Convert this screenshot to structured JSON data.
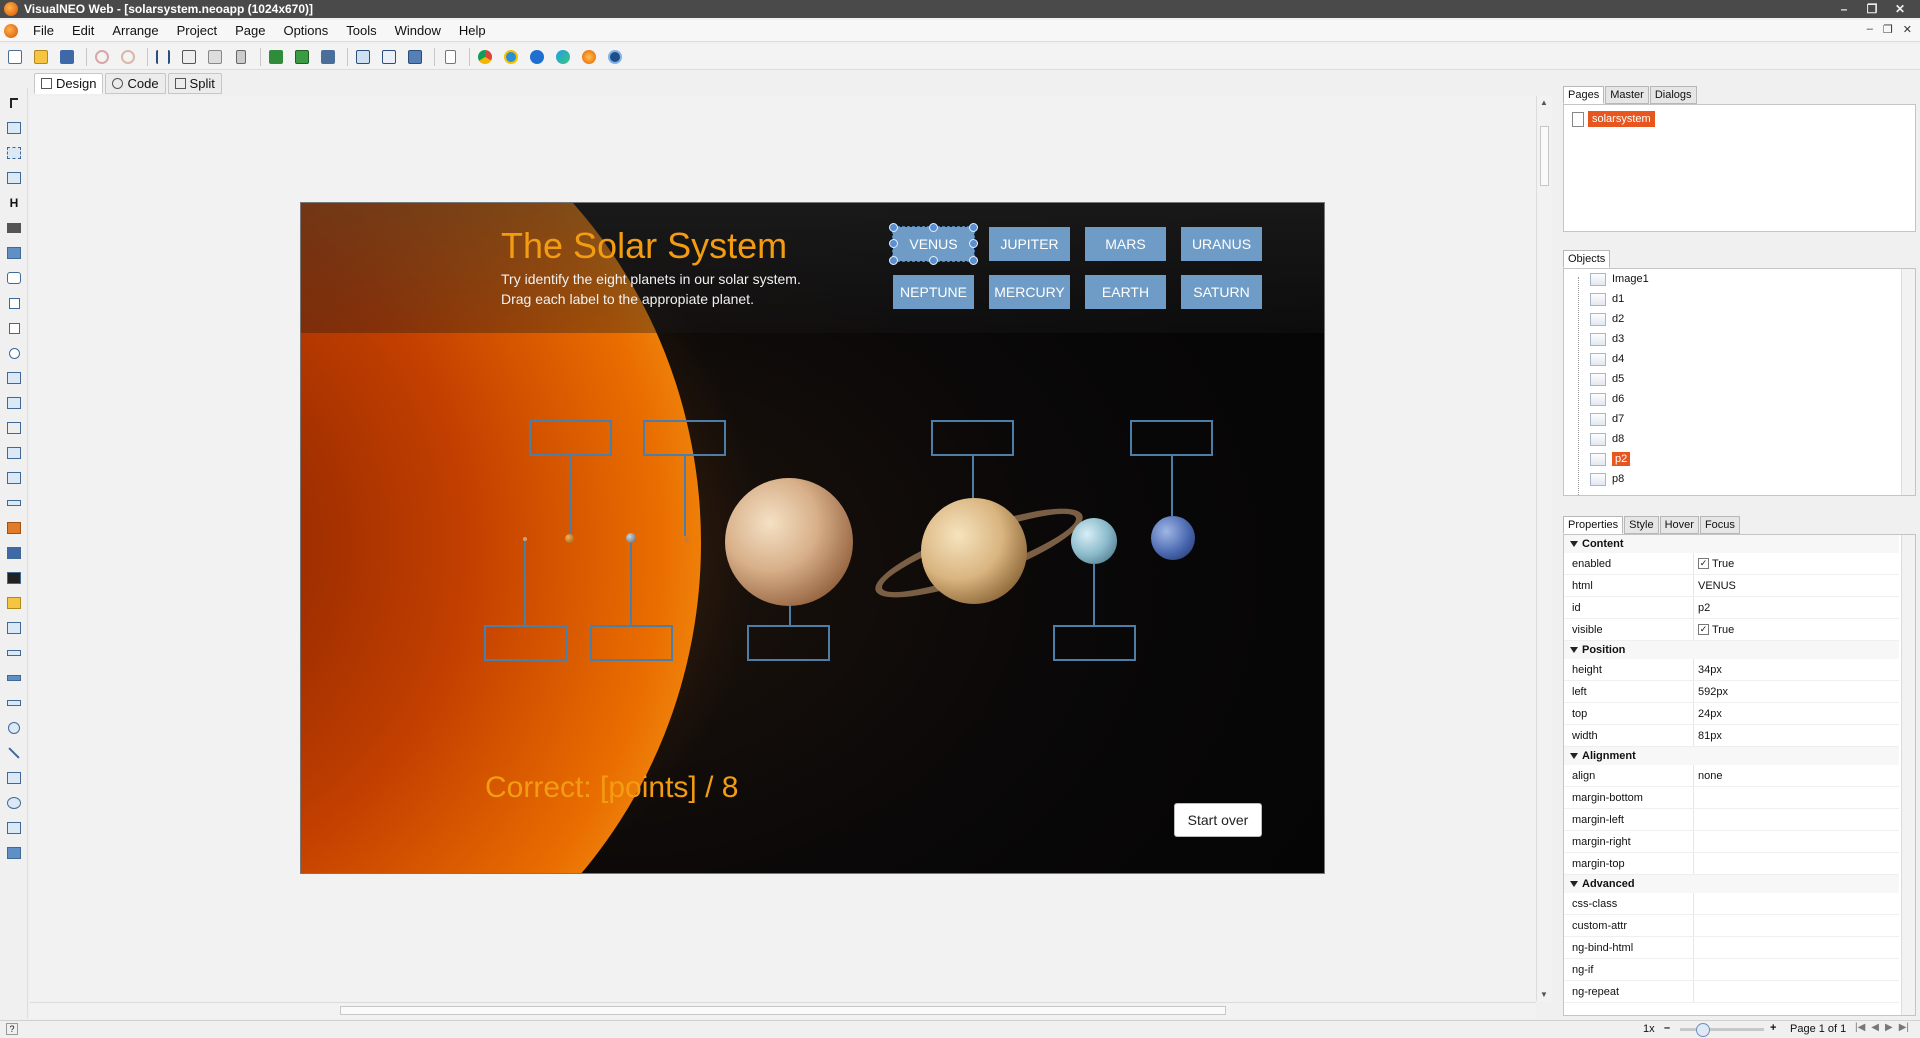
{
  "window": {
    "title": "VisualNEO Web - [solarsystem.neoapp (1024x670)]",
    "controls": [
      "–",
      "❐",
      "✕"
    ]
  },
  "menubar": {
    "items": [
      "File",
      "Edit",
      "Arrange",
      "Project",
      "Page",
      "Options",
      "Tools",
      "Window",
      "Help"
    ],
    "mdi_controls": [
      "–",
      "❐",
      "✕"
    ]
  },
  "toolbar": {
    "buttons": [
      "new-icon",
      "open-icon",
      "save-icon",
      "undo-icon",
      "redo-icon",
      "cut-icon",
      "copy-icon",
      "paste-icon",
      "delete-icon",
      "group-icon",
      "ungroup-icon",
      "order-icon",
      "page-icon",
      "preview-icon",
      "publish-icon",
      "doc-icon",
      "chrome-icon",
      "ie-icon",
      "edge-icon",
      "edge-new-icon",
      "firefox-icon",
      "other-browser-icon"
    ]
  },
  "view_tabs": [
    "Design",
    "Code",
    "Split"
  ],
  "app": {
    "title": "The Solar System",
    "subtitle1": "Try identify the eight planets in our solar system.",
    "subtitle2": "Drag each label to the appropiate planet.",
    "labels_row1": [
      "VENUS",
      "JUPITER",
      "MARS",
      "URANUS"
    ],
    "labels_row2": [
      "NEPTUNE",
      "MERCURY",
      "EARTH",
      "SATURN"
    ],
    "score": "Correct: [points] / 8",
    "start_over": "Start over",
    "colors": {
      "title": "#f39c12",
      "label_bg": "#6e9cc6",
      "drop_border": "#4d7ea8"
    }
  },
  "pages_panel": {
    "tabs": [
      "Pages",
      "Master",
      "Dialogs"
    ],
    "items": [
      "solarsystem"
    ]
  },
  "objects_panel": {
    "tabs": [
      "Objects"
    ],
    "items": [
      "Image1",
      "d1",
      "d2",
      "d3",
      "d4",
      "d5",
      "d6",
      "d7",
      "d8",
      "p2",
      "p8"
    ],
    "selected": "p2"
  },
  "properties_panel": {
    "tabs": [
      "Properties",
      "Style",
      "Hover",
      "Focus"
    ],
    "content": {
      "section": "Content",
      "rows": [
        [
          "enabled",
          "True"
        ],
        [
          "html",
          "VENUS"
        ],
        [
          "id",
          "p2"
        ],
        [
          "visible",
          "True"
        ]
      ]
    },
    "position": {
      "section": "Position",
      "rows": [
        [
          "height",
          "34px"
        ],
        [
          "left",
          "592px"
        ],
        [
          "top",
          "24px"
        ],
        [
          "width",
          "81px"
        ]
      ]
    },
    "alignment": {
      "section": "Alignment",
      "rows": [
        [
          "align",
          "none"
        ],
        [
          "margin-bottom",
          ""
        ],
        [
          "margin-left",
          ""
        ],
        [
          "margin-right",
          ""
        ],
        [
          "margin-top",
          ""
        ]
      ]
    },
    "advanced": {
      "section": "Advanced",
      "rows": [
        [
          "css-class",
          ""
        ],
        [
          "custom-attr",
          ""
        ],
        [
          "ng-bind-html",
          ""
        ],
        [
          "ng-if",
          ""
        ],
        [
          "ng-repeat",
          ""
        ]
      ]
    }
  },
  "statusbar": {
    "help": "?",
    "zoom": "1x",
    "zoom_minus": "–",
    "zoom_plus": "+",
    "page": "Page 1 of 1"
  }
}
